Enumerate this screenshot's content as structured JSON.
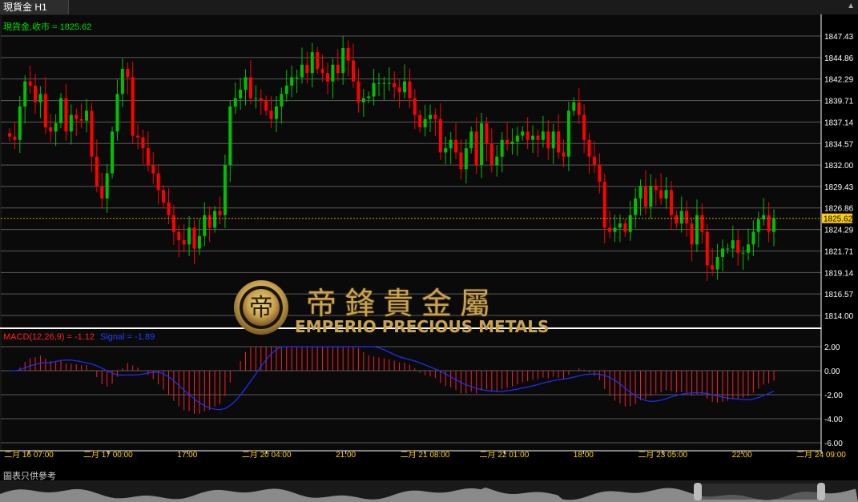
{
  "tab": {
    "title": "現貨金 H1"
  },
  "main_header": {
    "label": "現貨金,收市 = 1825.62",
    "color": "#00e000"
  },
  "price_axis": {
    "ticks": [
      "1847.43",
      "1844.86",
      "1842.29",
      "1839.71",
      "1837.14",
      "1834.57",
      "1832.00",
      "1829.43",
      "1826.86",
      "1824.29",
      "1821.71",
      "1819.14",
      "1816.57",
      "1814.00"
    ],
    "current_price": "1825.62",
    "ylim": [
      1814.0,
      1847.43
    ]
  },
  "macd_header": {
    "macd_label": "MACD(12,26,9) = -1.12",
    "signal_label": "Signal = -1.89",
    "macd_color": "#ff2020",
    "signal_color": "#2040ff"
  },
  "macd_axis": {
    "ticks": [
      "2.00",
      "0.00",
      "-2.00",
      "-4.00",
      "-6.00"
    ],
    "ylim": [
      -6.0,
      2.0
    ]
  },
  "time_axis": {
    "labels": [
      "二月 16 07:00",
      "二月 17 00:00",
      "17:00",
      "二月 20 04:00",
      "21:00",
      "二月 21 08:00",
      "二月 22 01:00",
      "18:00",
      "二月 23 05:00",
      "22:00",
      "二月 24 09:00"
    ]
  },
  "watermark": {
    "cn": "帝鋒貴金屬",
    "en": "EMPERIO PRECIOUS METALS",
    "logo_letter": "帝"
  },
  "footer": {
    "note": "圖表只供參考"
  },
  "colors": {
    "up": "#00c000",
    "down": "#ff0000",
    "grid": "#5a5a5a",
    "axis_text": "#ffffff",
    "price_line": "#ffd000",
    "time_text": "#ffd000"
  },
  "chart_data": {
    "type": "candlestick",
    "timeframe": "H1",
    "close_last": 1825.62,
    "closes": [
      1835.4,
      1835.0,
      1839.0,
      1842.0,
      1841.5,
      1839.5,
      1840.5,
      1836.5,
      1836.0,
      1837.0,
      1840.0,
      1836.0,
      1838.0,
      1837.5,
      1837.3,
      1838.5,
      1833.0,
      1829.5,
      1828.0,
      1831.0,
      1836.0,
      1840.5,
      1843.5,
      1842.5,
      1835.5,
      1835.3,
      1834.0,
      1832.0,
      1831.0,
      1829.0,
      1827.5,
      1826.0,
      1824.0,
      1823.0,
      1822.5,
      1824.5,
      1822.0,
      1823.5,
      1826.0,
      1824.5,
      1826.5,
      1826.0,
      1832.0,
      1839.0,
      1840.0,
      1841.0,
      1842.5,
      1840.0,
      1840.0,
      1839.7,
      1838.5,
      1837.5,
      1839.0,
      1840.5,
      1841.5,
      1842.5,
      1842.5,
      1844.0,
      1843.0,
      1845.5,
      1843.5,
      1843.0,
      1842.0,
      1844.0,
      1843.0,
      1846.0,
      1844.5,
      1842.0,
      1839.5,
      1840.0,
      1840.2,
      1841.8,
      1841.8,
      1841.8,
      1841.8,
      1841.3,
      1840.7,
      1842.0,
      1840.0,
      1838.0,
      1836.5,
      1837.5,
      1838.0,
      1837.5,
      1833.5,
      1834.0,
      1835.0,
      1833.5,
      1831.5,
      1834.0,
      1836.0,
      1832.0,
      1837.0,
      1834.5,
      1832.0,
      1833.0,
      1835.0,
      1834.5,
      1834.8,
      1835.5,
      1836.0,
      1835.0,
      1835.5,
      1835.0,
      1836.0,
      1834.0,
      1836.0,
      1833.5,
      1833.0,
      1838.5,
      1839.5,
      1838.0,
      1835.0,
      1833.0,
      1832.0,
      1830.0,
      1824.5,
      1824.0,
      1824.5,
      1825.0,
      1824.0,
      1826.0,
      1828.0,
      1829.5,
      1827.0,
      1829.5,
      1829.0,
      1828.0,
      1829.0,
      1826.0,
      1825.0,
      1826.5,
      1825.0,
      1822.5,
      1826.0,
      1824.0,
      1820.0,
      1819.5,
      1821.0,
      1822.0,
      1822.0,
      1823.0,
      1821.5,
      1821.5,
      1822.5,
      1824.0,
      1825.5,
      1826.0,
      1824.0,
      1825.62
    ]
  }
}
